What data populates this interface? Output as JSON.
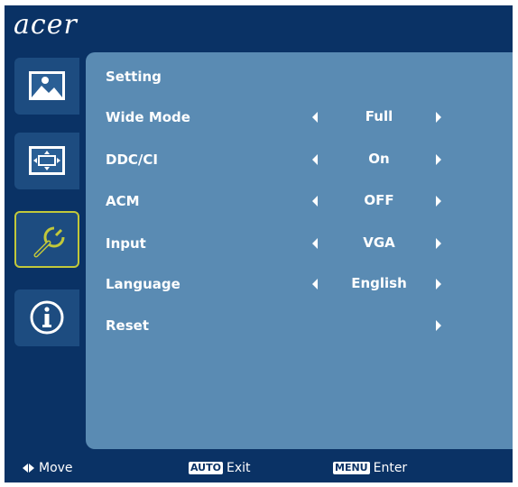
{
  "brand": "acer",
  "colors": {
    "background": "#0a3265",
    "panel": "#5a8bb3",
    "tab": "#1d4c80",
    "active_border": "#c2c83a"
  },
  "sidebar": {
    "tabs": [
      {
        "icon": "picture-icon",
        "active": false
      },
      {
        "icon": "position-icon",
        "active": false
      },
      {
        "icon": "setting-wrench-icon",
        "active": true
      },
      {
        "icon": "information-icon",
        "active": false
      }
    ]
  },
  "panel": {
    "title": "Setting",
    "rows": [
      {
        "label": "Wide Mode",
        "value": "Full",
        "has_left": true,
        "has_right": true
      },
      {
        "label": "DDC/CI",
        "value": "On",
        "has_left": true,
        "has_right": true
      },
      {
        "label": "ACM",
        "value": "OFF",
        "has_left": true,
        "has_right": true
      },
      {
        "label": "Input",
        "value": "VGA",
        "has_left": true,
        "has_right": true
      },
      {
        "label": "Language",
        "value": "English",
        "has_left": true,
        "has_right": true
      },
      {
        "label": "Reset",
        "value": "",
        "has_left": false,
        "has_right": true
      }
    ]
  },
  "footer": {
    "move": "Move",
    "auto_key": "AUTO",
    "exit": "Exit",
    "menu_key": "MENU",
    "enter": "Enter"
  }
}
